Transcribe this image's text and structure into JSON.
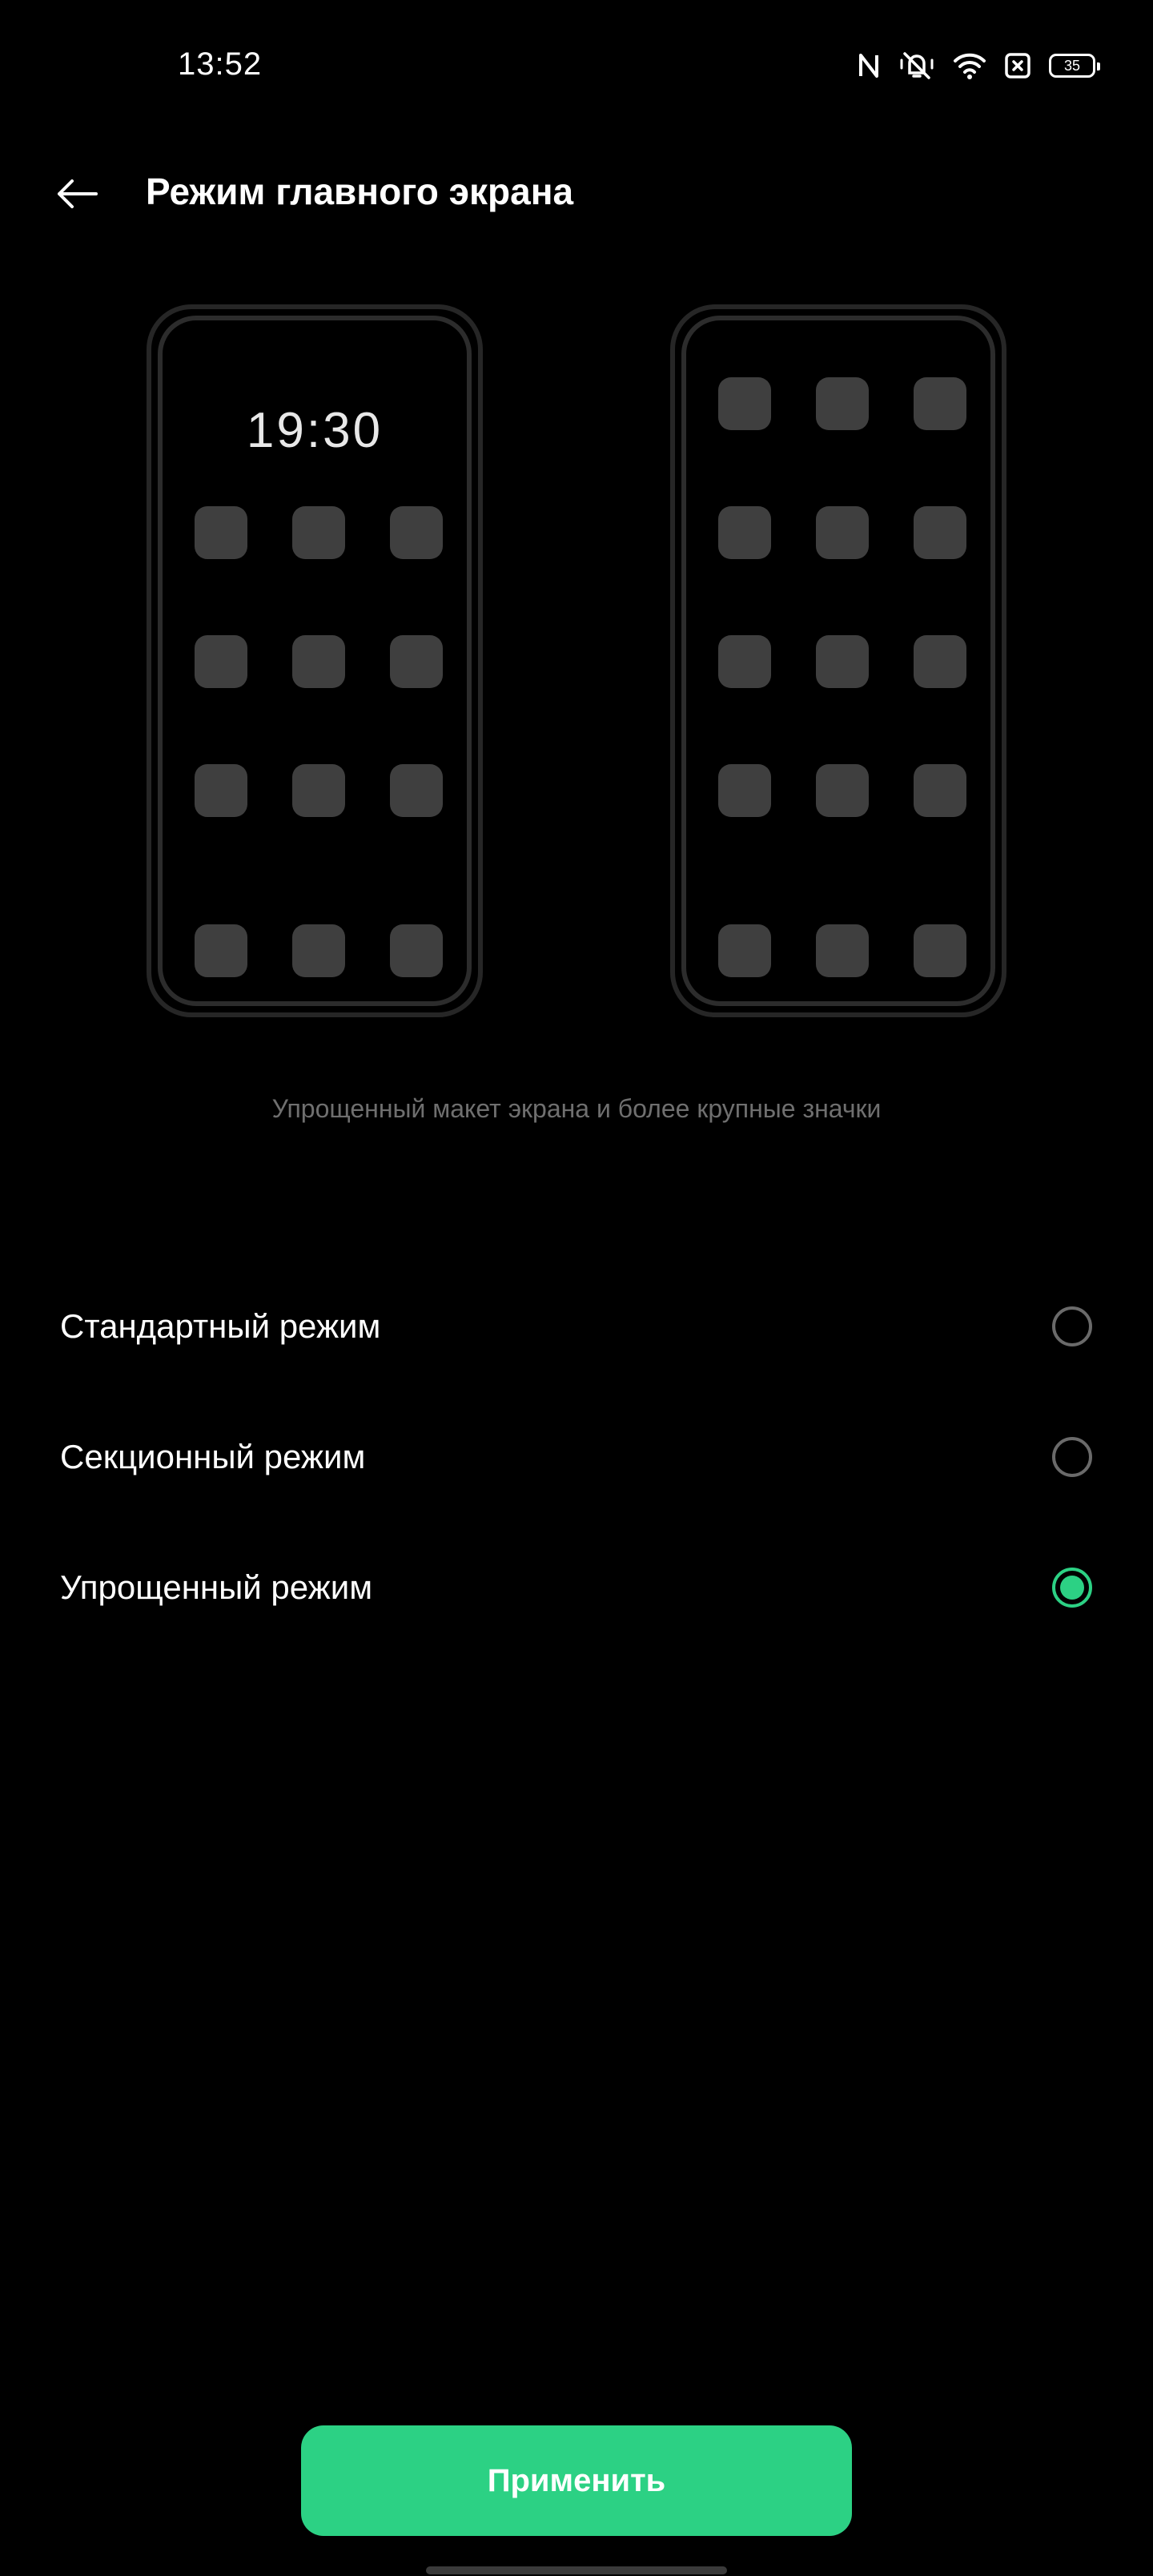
{
  "status_bar": {
    "time": "13:52",
    "battery_level": "35",
    "icons": [
      "nfc-icon",
      "mute-icon",
      "wifi-icon",
      "sim-missing-icon",
      "battery-icon"
    ]
  },
  "header": {
    "title": "Режим главного экрана",
    "back_icon": "arrow-left-icon"
  },
  "previews": {
    "standard": {
      "clock": "19:30"
    }
  },
  "description": "Упрощенный макет экрана и более крупные значки",
  "options": [
    {
      "label": "Стандартный режим",
      "selected": false
    },
    {
      "label": "Секционный режим",
      "selected": false
    },
    {
      "label": "Упрощенный режим",
      "selected": true
    }
  ],
  "apply_button": {
    "label": "Применить"
  },
  "colors": {
    "accent": "#2cd184",
    "background": "#000000",
    "description_text": "#6f6f6f"
  }
}
